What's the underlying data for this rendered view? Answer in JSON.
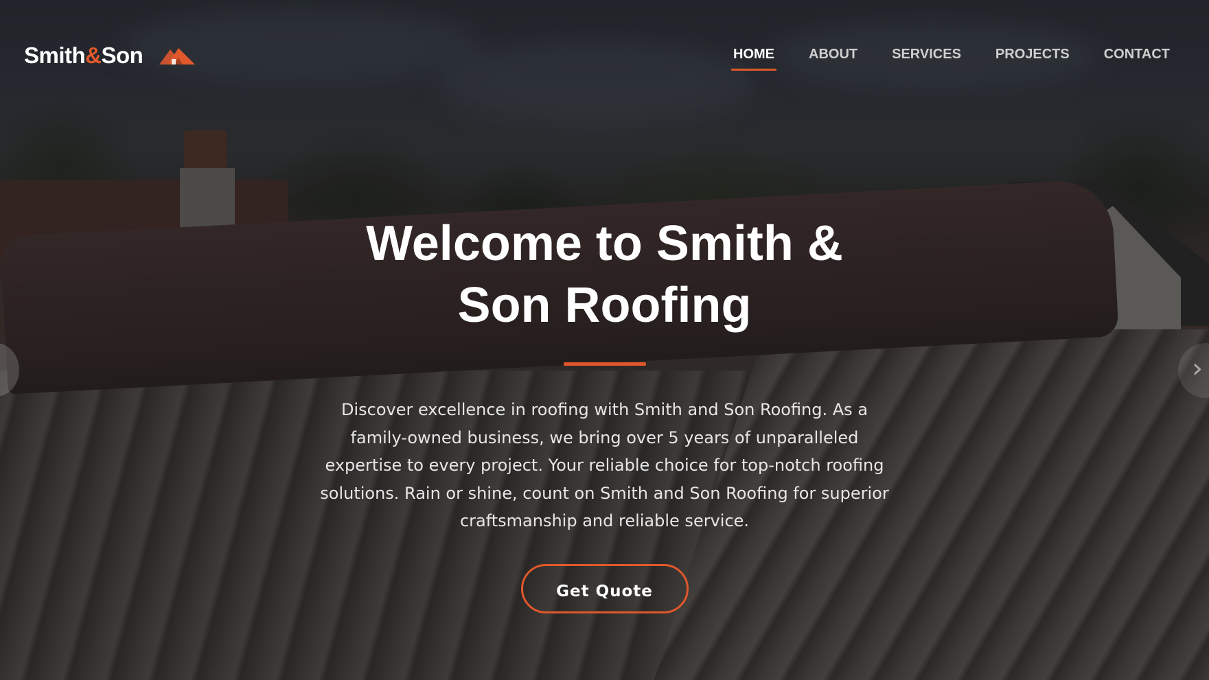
{
  "brand": {
    "name_part1": "Smith",
    "ampersand": "&",
    "name_part2": "Son",
    "logo_icon": "house-roof-icon",
    "accent_color": "#e0582b"
  },
  "nav": {
    "items": [
      {
        "label": "HOME",
        "active": true
      },
      {
        "label": "ABOUT",
        "active": false
      },
      {
        "label": "SERVICES",
        "active": false
      },
      {
        "label": "PROJECTS",
        "active": false
      },
      {
        "label": "CONTACT",
        "active": false
      }
    ]
  },
  "hero": {
    "headline": "Welcome to Smith & Son Roofing",
    "description": "Discover excellence in roofing with Smith and Son Roofing. As a family-owned business, we bring over 5 years of unparalleled expertise to every project. Your reliable choice for top-notch roofing solutions. Rain or shine, count on Smith and Son Roofing for superior craftsmanship and reliable service.",
    "cta_label": "Get Quote"
  },
  "carousel": {
    "prev_icon": "chevron-left-icon",
    "next_icon": "chevron-right-icon",
    "next_glyph": "›"
  }
}
